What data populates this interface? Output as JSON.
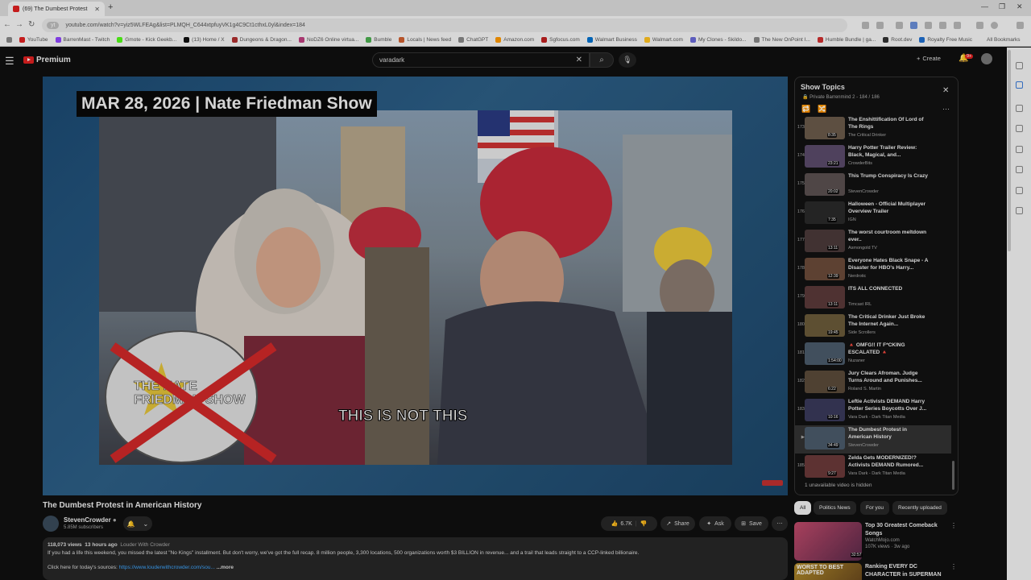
{
  "browser": {
    "tab_title": "(69) The Dumbest Protest",
    "url_pill": "yt",
    "url": "youtube.com/watch?v=yiz5WLFEAg&list=PLMQH_C644xtpfuyVK1g4C9Ct1cthxL0yl&index=184",
    "bookmarks": [
      "YouTube",
      "BarrenMast - Twitch",
      "Gmote - Kick Geekb...",
      "(13) Home / X",
      "Dungeons & Dragon...",
      "NoDZ6 Online virtua...",
      "Bumble",
      "Locals | News feed",
      "ChatGPT",
      "Amazon.com",
      "Sgfocus.com",
      "Walmart Business",
      "Walmart.com",
      "My Clones - Skildo...",
      "The New OnPoint I...",
      "Humble Bundle | ga...",
      "Root.dev",
      "Royalty Free Music"
    ],
    "all_bookmarks": "All Bookmarks"
  },
  "yt": {
    "logo_text": "Premium",
    "search_value": "varadark",
    "create_label": "Create",
    "notif_count": "9+"
  },
  "video": {
    "date_banner": "MAR 28, 2026 | Nate Friedman Show",
    "caption": "THIS IS NOT THIS",
    "sign_text": "THE NATE FRIEDMAN SHOW",
    "title": "The Dumbest Protest in American History",
    "channel": "StevenCrowder",
    "subs": "5.85M subscribers",
    "likes": "6.7K",
    "share": "Share",
    "ask": "Ask",
    "save": "Save",
    "views": "118,073 views",
    "age": "13 hours ago",
    "channel_tag": "Louder With Crowder",
    "description": "If you had a life this weekend, you missed the latest \"No Kings\" installment. But don't worry, we've got the full recap. 8 million people, 3,300 locations, 500 organizations worth $3 BILLION in revenue... and a trail that leads straight to a CCP-linked billionaire.",
    "sources_label": "Click here for today's sources:",
    "sources_link": "https://www.louderwithcrowder.com/sou...",
    "more": "...more"
  },
  "playlist": {
    "title": "Show Topics",
    "subtitle": "Private  Barrenmind 2 - 184 / 186",
    "items": [
      {
        "num": "173",
        "title": "The Enshittification Of Lord of The Rings",
        "channel": "The Critical Drinker",
        "dur": "8:35",
        "color": "#6a5a4a"
      },
      {
        "num": "174",
        "title": "Harry Potter Trailer Review: Black, Magical, and...",
        "channel": "CrowderBits",
        "dur": "23:21",
        "color": "#5a4a6a"
      },
      {
        "num": "175",
        "title": "This Trump Conspiracy Is Crazy",
        "channel": "StevenCrowder",
        "dur": "20:02",
        "color": "#5a5050"
      },
      {
        "num": "176",
        "title": "Halloween - Official Multiplayer Overview Trailer",
        "channel": "IGN",
        "dur": "7:35",
        "color": "#2a2a2a"
      },
      {
        "num": "177",
        "title": "The worst courtroom meltdown ever..",
        "channel": "Asmongold TV",
        "dur": "13:11",
        "color": "#4a3a3a"
      },
      {
        "num": "178",
        "title": "Everyone Hates Black Snape - A Disaster for HBO's Harry...",
        "channel": "Nerdrotic",
        "dur": "12:39",
        "color": "#6a4a3a"
      },
      {
        "num": "179",
        "title": "ITS ALL CONNECTED",
        "channel": "Timcast IRL",
        "dur": "13:11",
        "color": "#5a3a3a"
      },
      {
        "num": "180",
        "title": "The Critical Drinker Just Broke The Internet Again...",
        "channel": "Side Scrollers",
        "dur": "19:45",
        "color": "#6a5a3a"
      },
      {
        "num": "181",
        "title": "🔺 OMFG!! IT F*CKING ESCALATED 🔺",
        "channel": "Nuzaner",
        "dur": "1:54:00",
        "color": "#4a5a6a"
      },
      {
        "num": "182",
        "title": "Jury Clears Afroman. Judge Turns Around and Punishes...",
        "channel": "Roland S. Martin",
        "dur": "6:22",
        "color": "#5a4a3a"
      },
      {
        "num": "183",
        "title": "Leftie Activists DEMAND Harry Potter Series Boycotts Over J...",
        "channel": "Vara Dark - Dark Titan Media",
        "dur": "10:16",
        "color": "#3a3a5a"
      },
      {
        "num": "▶",
        "title": "The Dumbest Protest in American History",
        "channel": "StevenCrowder",
        "dur": "34:49",
        "color": "#4a5a6a",
        "active": true
      },
      {
        "num": "185",
        "title": "Zelda Gets MODERNIZED!? Activists DEMAND Rumored...",
        "channel": "Vara Dark - Dark Titan Media",
        "dur": "9:27",
        "color": "#6a3a3a"
      }
    ],
    "unavailable": "1 unavailable video is hidden"
  },
  "chips": [
    "All",
    "Politics News",
    "For you",
    "Recently uploaded"
  ],
  "recommended": [
    {
      "title": "Top 30 Greatest Comeback Songs",
      "channel": "WatchMojo.com",
      "meta": "107K views · 3w ago",
      "dur": "32:57",
      "color": "#8a3a5a"
    },
    {
      "title": "Ranking EVERY DC CHARACTER in SUPERMAN by...",
      "channel": "",
      "meta": "",
      "dur": "",
      "color": "#7a5a2a",
      "thumb_text": "WORST TO BEST ADAPTED"
    }
  ],
  "colors": {
    "accent": "#e02020",
    "link": "#3ea6ff",
    "bg": "#0f0f0f"
  }
}
